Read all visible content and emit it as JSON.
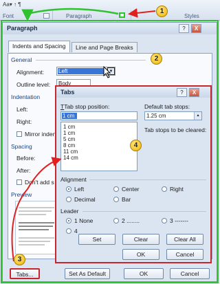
{
  "ribbon": {
    "row_text": "Aa▾  ↑  ¶",
    "font_group": "Font",
    "paragraph_group": "Paragraph",
    "styles_group": "Styles"
  },
  "paragraph_dialog": {
    "title": "Paragraph",
    "help": "?",
    "close": "X",
    "tabs": [
      "Indents and Spacing",
      "Line and Page Breaks"
    ],
    "general": "General",
    "alignment_label": "Alignment:",
    "alignment_value": "Left",
    "outline_label": "Outline level:",
    "outline_value": "Body Text",
    "indentation": "Indentation",
    "left_label": "Left:",
    "right_label": "Right:",
    "mirror_label": "Mirror inden",
    "spacing": "Spacing",
    "before_label": "Before:",
    "after_label": "After:",
    "dont_add_label": "Don't add s",
    "preview": "Preview",
    "buttons": {
      "tabs": "Tabs...",
      "set_default": "Set As Default",
      "ok": "OK",
      "cancel": "Cancel"
    }
  },
  "tabs_dialog": {
    "title": "Tabs",
    "help": "?",
    "close": "X",
    "tab_stop_label": "Tab stop position:",
    "tab_stop_value": "1 cm",
    "tab_stops": [
      "1 cm",
      "1 cm",
      "5 cm",
      "8 cm",
      "11 cm",
      "14 cm"
    ],
    "default_label": "Default tab stops:",
    "default_value": "1.25 cm",
    "cleared_label": "Tab stops to be cleared:",
    "alignment": "Alignment",
    "align_options": [
      "Left",
      "Center",
      "Right",
      "Decimal",
      "Bar"
    ],
    "leader": "Leader",
    "leader_options": [
      "1 None",
      "2 ........",
      "3 -------",
      "4 ____"
    ],
    "buttons": {
      "set": "Set",
      "clear": "Clear",
      "clear_all": "Clear All",
      "ok": "OK",
      "cancel": "Cancel"
    }
  },
  "annotations": {
    "b1": "1",
    "b2": "2",
    "b3": "3",
    "b4": "4"
  }
}
